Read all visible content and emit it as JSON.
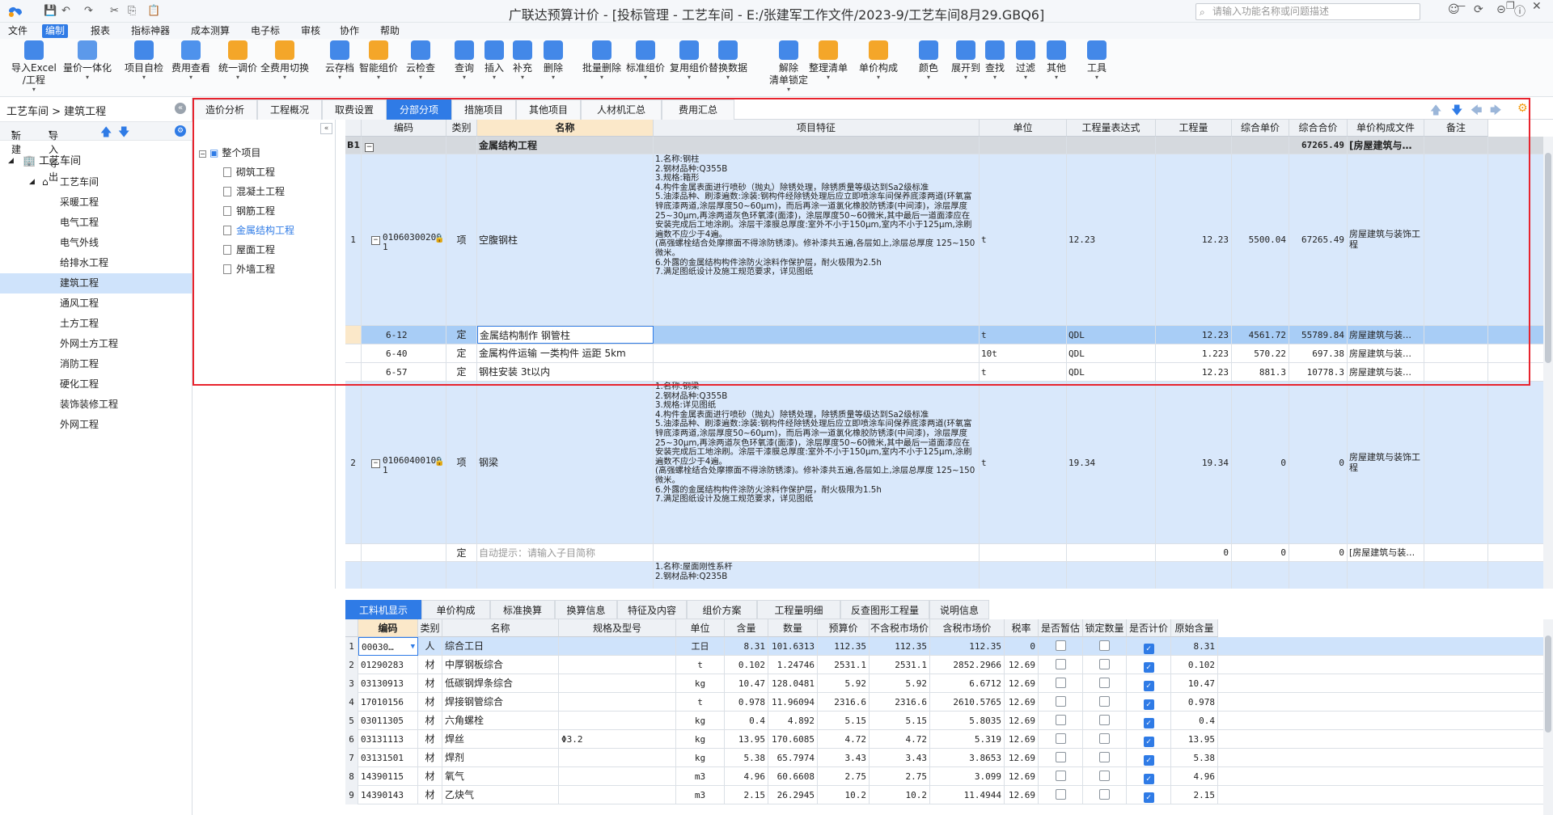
{
  "titlebar": {
    "app_title": "广联达预算计价 - [投标管理 - 工艺车间 - E:/张建军工作文件/2023-9/工艺车间8月29.GBQ6]",
    "search_placeholder": "请输入功能名称或问题描述",
    "accent": "#2f7be6"
  },
  "menu": [
    "文件",
    "编制",
    "报表",
    "指标神器",
    "成本测算",
    "电子标",
    "审核",
    "协作",
    "帮助"
  ],
  "menu_active": "编制",
  "ribbon": [
    {
      "label": "导入Excel",
      "label2": "/工程",
      "icon": "import-excel-icon",
      "color": "#2f7be6"
    },
    {
      "label": "量价一体化",
      "icon": "price-integration-icon",
      "color": "#4a8ee8"
    },
    {
      "label": "项目自检",
      "icon": "self-check-icon",
      "color": "#2f7be6"
    },
    {
      "label": "费用查看",
      "icon": "cost-view-icon",
      "color": "#3b86ea"
    },
    {
      "label": "统一调价",
      "icon": "adjust-price-icon",
      "color": "#f39c12"
    },
    {
      "label": "全费用切换",
      "icon": "full-cost-icon",
      "color": "#f39c12"
    },
    {
      "label": "云存档",
      "icon": "cloud-save-icon",
      "color": "#2f7be6"
    },
    {
      "label": "智能组价",
      "icon": "smart-price-icon",
      "color": "#f39c12"
    },
    {
      "label": "云检查",
      "icon": "cloud-check-icon",
      "color": "#2f7be6"
    },
    {
      "label": "查询",
      "icon": "query-icon",
      "color": "#2f7be6"
    },
    {
      "label": "插入",
      "icon": "insert-icon",
      "color": "#2f7be6"
    },
    {
      "label": "补充",
      "icon": "supplement-icon",
      "color": "#2f7be6"
    },
    {
      "label": "删除",
      "icon": "delete-icon",
      "color": "#2f7be6"
    },
    {
      "label": "批量删除",
      "icon": "batch-delete-icon",
      "color": "#2f7be6"
    },
    {
      "label": "标准组价",
      "icon": "standard-price-icon",
      "color": "#2f7be6"
    },
    {
      "label": "复用组价",
      "icon": "reuse-price-icon",
      "color": "#2f7be6"
    },
    {
      "label": "替换数据",
      "icon": "replace-data-icon",
      "color": "#2f7be6"
    },
    {
      "label": "解除",
      "label2": "清单锁定",
      "icon": "unlock-icon",
      "color": "#2f7be6"
    },
    {
      "label": "整理清单",
      "icon": "organize-list-icon",
      "color": "#f39c12"
    },
    {
      "label": "单价构成",
      "icon": "unit-price-icon",
      "color": "#f39c12"
    },
    {
      "label": "颜色",
      "icon": "color-icon",
      "color": "#2f7be6"
    },
    {
      "label": "展开到",
      "icon": "expand-to-icon",
      "color": "#2f7be6"
    },
    {
      "label": "查找",
      "icon": "find-icon",
      "color": "#2f7be6"
    },
    {
      "label": "过滤",
      "icon": "filter-icon",
      "color": "#2f7be6"
    },
    {
      "label": "其他",
      "icon": "other-icon",
      "color": "#2f7be6"
    },
    {
      "label": "工具",
      "icon": "tools-icon",
      "color": "#2f7be6"
    }
  ],
  "left": {
    "breadcrumb": "工艺车间 > 建筑工程",
    "new_label": "新建",
    "import_export_label": "导入导出",
    "root": "工艺车间",
    "child": "工艺车间",
    "items": [
      "采暖工程",
      "电气工程",
      "电气外线",
      "给排水工程",
      "建筑工程",
      "通风工程",
      "土方工程",
      "外网土方工程",
      "消防工程",
      "硬化工程",
      "装饰装修工程",
      "外网工程"
    ],
    "selected": "建筑工程"
  },
  "tabs": [
    "造价分析",
    "工程概况",
    "取费设置",
    "分部分项",
    "措施项目",
    "其他项目",
    "人材机汇总",
    "费用汇总"
  ],
  "tab_active": "分部分项",
  "parts_tree": {
    "root": "整个项目",
    "items": [
      "砌筑工程",
      "混凝土工程",
      "钢筋工程",
      "金属结构工程",
      "屋面工程",
      "外墙工程"
    ],
    "selected": "金属结构工程"
  },
  "grid": {
    "headers": [
      "",
      "编码",
      "类别",
      "名称",
      "项目特征",
      "单位",
      "工程量表达式",
      "工程量",
      "综合单价",
      "综合合价",
      "单价构成文件",
      "备注"
    ],
    "section": {
      "code": "B1",
      "name": "金属结构工程",
      "total": "67265.49",
      "file": "[房屋建筑与…"
    },
    "item1": {
      "no": "1",
      "code": "01060300200",
      "code2": "1",
      "cat": "项",
      "name": "空腹钢柱",
      "unit": "t",
      "expr": "12.23",
      "qty": "12.23",
      "price": "5500.04",
      "amount": "67265.49",
      "file": "房屋建筑与装饰工程",
      "features": "1.名称:钢柱\n2.钢材品种:Q355B\n3.规格:箱形\n4.构件金属表面进行喷砂（抛丸）除锈处理，除锈质量等级达到Sa2级标准\n5.油漆品种、刷漆遍数:涂装:钢构件经除锈处理后应立即喷涂车间保养底漆两道(环氧富锌底漆两道,涂层厚度50~60μm)，而后再涂一道氯化橡胶防锈漆(中间漆)，涂层厚度25~30μm,再涂两道灰色环氧漆(面漆)，涂层厚度50~60微米,其中最后一道面漆应在安装完成后工地涂刷。涂层干漆膜总厚度:室外不小于150μm,室内不小于125μm,涂刷遍数不应少于4遍。\n(高强螺栓结合处摩擦面不得涂防锈漆)。修补漆共五遍,各层如上,涂层总厚度 125~150微米。\n6.外露的金属结构构件涂防火涂料作保护层，耐火极限为2.5h\n7.满足图纸设计及施工规范要求，详见图纸"
    },
    "subs": [
      {
        "code": "6-12",
        "cat": "定",
        "name": "金属结构制作 钢管柱",
        "unit": "t",
        "expr": "QDL",
        "qty": "12.23",
        "price": "4561.72",
        "amount": "55789.84",
        "file": "房屋建筑与装…"
      },
      {
        "code": "6-40",
        "cat": "定",
        "name": "金属构件运输 一类构件 运距 5km",
        "unit": "10t",
        "expr": "QDL",
        "qty": "1.223",
        "price": "570.22",
        "amount": "697.38",
        "file": "房屋建筑与装…"
      },
      {
        "code": "6-57",
        "cat": "定",
        "name": "钢柱安装 3t以内",
        "unit": "t",
        "expr": "QDL",
        "qty": "12.23",
        "price": "881.3",
        "amount": "10778.3",
        "file": "房屋建筑与装…"
      }
    ],
    "item2": {
      "no": "2",
      "code": "01060400100",
      "code2": "1",
      "cat": "项",
      "name": "钢梁",
      "unit": "t",
      "expr": "19.34",
      "qty": "19.34",
      "price": "0",
      "amount": "0",
      "file": "房屋建筑与装饰工程",
      "features": "1.名称:钢梁\n2.钢材品种:Q355B\n3.规格:详见图纸\n4.构件金属表面进行喷砂（抛丸）除锈处理，除锈质量等级达到Sa2级标准\n5.油漆品种、刷漆遍数:涂装:钢构件经除锈处理后应立即喷涂车间保养底漆两道(环氧富锌底漆两道,涂层厚度50~60μm)，而后再涂一道氯化橡胶防锈漆(中间漆)，涂层厚度25~30μm,再涂两道灰色环氧漆(面漆)，涂层厚度50~60微米,其中最后一道面漆应在安装完成后工地涂刷。涂层干漆膜总厚度:室外不小于150μm,室内不小于125μm,涂刷遍数不应少于4遍。\n(高强螺栓结合处摩擦面不得涂防锈漆)。修补漆共五遍,各层如上,涂层总厚度 125~150微米。\n6.外露的金属结构构件涂防火涂料作保护层，耐火极限为1.5h\n7.满足图纸设计及施工规范要求，详见图纸"
    },
    "hint_row": {
      "cat": "定",
      "hint": "自动提示：请输入子目简称",
      "qty": "0",
      "price": "0",
      "amount": "0",
      "file": "[房屋建筑与装…"
    },
    "item3_features": "1.名称:屋面刚性系杆\n2.钢材品种:Q235B"
  },
  "bottom_tabs": [
    "工料机显示",
    "单价构成",
    "标准换算",
    "换算信息",
    "特征及内容",
    "组价方案",
    "工程量明细",
    "反查图形工程量",
    "说明信息"
  ],
  "bottom_tab_active": "工料机显示",
  "bottom": {
    "headers": [
      "",
      "编码",
      "类别",
      "名称",
      "规格及型号",
      "单位",
      "含量",
      "数量",
      "预算价",
      "不含税市场价",
      "含税市场价",
      "税率",
      "是否暂估",
      "锁定数量",
      "是否计价",
      "原始含量"
    ],
    "rows": [
      {
        "no": "1",
        "code": "00030…",
        "cat": "人",
        "name": "综合工日",
        "spec": "",
        "unit": "工日",
        "content": "8.31",
        "qty": "101.6313",
        "budget": "112.35",
        "market": "112.35",
        "market_tax": "112.35",
        "tax": "0",
        "orig": "8.31"
      },
      {
        "no": "2",
        "code": "01290283",
        "cat": "材",
        "name": "中厚钢板综合",
        "spec": "",
        "unit": "t",
        "content": "0.102",
        "qty": "1.24746",
        "budget": "2531.1",
        "market": "2531.1",
        "market_tax": "2852.2966",
        "tax": "12.69",
        "orig": "0.102"
      },
      {
        "no": "3",
        "code": "03130913",
        "cat": "材",
        "name": "低碳钢焊条综合",
        "spec": "",
        "unit": "kg",
        "content": "10.47",
        "qty": "128.0481",
        "budget": "5.92",
        "market": "5.92",
        "market_tax": "6.6712",
        "tax": "12.69",
        "orig": "10.47"
      },
      {
        "no": "4",
        "code": "17010156",
        "cat": "材",
        "name": "焊接钢管综合",
        "spec": "",
        "unit": "t",
        "content": "0.978",
        "qty": "11.96094",
        "budget": "2316.6",
        "market": "2316.6",
        "market_tax": "2610.5765",
        "tax": "12.69",
        "orig": "0.978"
      },
      {
        "no": "5",
        "code": "03011305",
        "cat": "材",
        "name": "六角螺栓",
        "spec": "",
        "unit": "kg",
        "content": "0.4",
        "qty": "4.892",
        "budget": "5.15",
        "market": "5.15",
        "market_tax": "5.8035",
        "tax": "12.69",
        "orig": "0.4"
      },
      {
        "no": "6",
        "code": "03131113",
        "cat": "材",
        "name": "焊丝",
        "spec": "Φ3.2",
        "unit": "kg",
        "content": "13.95",
        "qty": "170.6085",
        "budget": "4.72",
        "market": "4.72",
        "market_tax": "5.319",
        "tax": "12.69",
        "orig": "13.95"
      },
      {
        "no": "7",
        "code": "03131501",
        "cat": "材",
        "name": "焊剂",
        "spec": "",
        "unit": "kg",
        "content": "5.38",
        "qty": "65.7974",
        "budget": "3.43",
        "market": "3.43",
        "market_tax": "3.8653",
        "tax": "12.69",
        "orig": "5.38"
      },
      {
        "no": "8",
        "code": "14390115",
        "cat": "材",
        "name": "氧气",
        "spec": "",
        "unit": "m3",
        "content": "4.96",
        "qty": "60.6608",
        "budget": "2.75",
        "market": "2.75",
        "market_tax": "3.099",
        "tax": "12.69",
        "orig": "4.96"
      },
      {
        "no": "9",
        "code": "14390143",
        "cat": "材",
        "name": "乙炔气",
        "spec": "",
        "unit": "m3",
        "content": "2.15",
        "qty": "26.2945",
        "budget": "10.2",
        "market": "10.2",
        "market_tax": "11.4944",
        "tax": "12.69",
        "orig": "2.15"
      }
    ]
  }
}
